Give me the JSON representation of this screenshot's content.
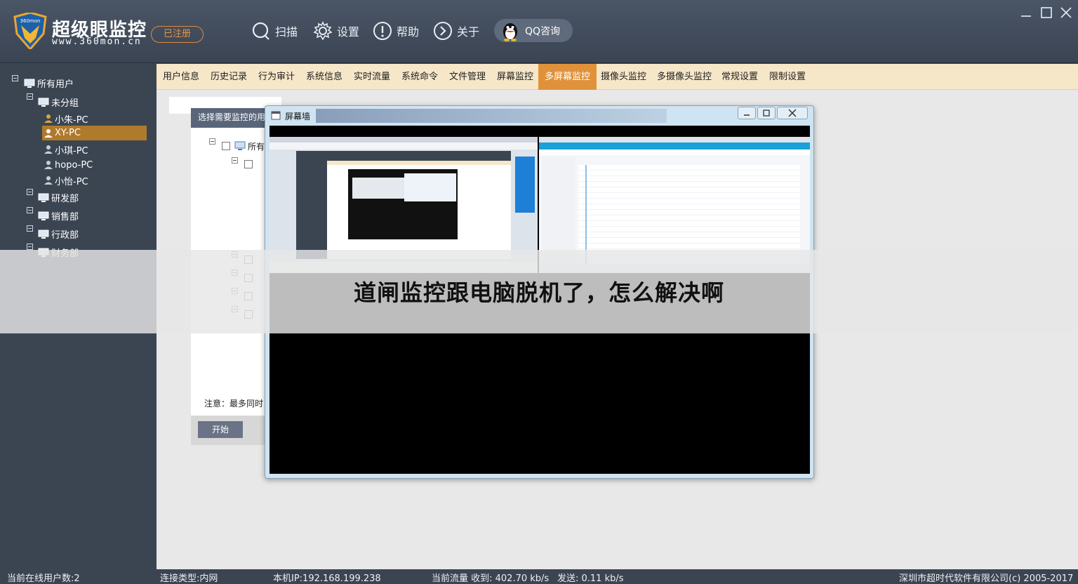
{
  "app": {
    "title": "超级眼监控",
    "url": "www.360mon.cn",
    "badge": "已注册",
    "colors": {
      "accent": "#e0923a",
      "header": "#3b4552",
      "tabbar": "#f7e7c9"
    }
  },
  "nav": {
    "scan": "扫描",
    "settings": "设置",
    "help": "帮助",
    "about": "关于",
    "qq": "QQ咨询"
  },
  "sidebar": {
    "root": "所有用户",
    "groups": [
      {
        "label": "未分组"
      },
      {
        "label": "研发部"
      },
      {
        "label": "销售部"
      },
      {
        "label": "行政部"
      },
      {
        "label": "财务部"
      }
    ],
    "users": [
      "小朱-PC",
      "XY-PC",
      "小琪-PC",
      "hopo-PC",
      "小怡-PC"
    ],
    "selected_user": "XY-PC"
  },
  "tabs": [
    "用户信息",
    "历史记录",
    "行为审计",
    "系统信息",
    "实时流量",
    "系统命令",
    "文件管理",
    "屏幕监控",
    "多屏幕监控",
    "摄像头监控",
    "多摄像头监控",
    "常规设置",
    "限制设置"
  ],
  "active_tab": "多屏幕监控",
  "panel": {
    "header": "选择需要监控的用",
    "tree_root": "所有",
    "note": "注意：最多同时",
    "start_button": "开始"
  },
  "wall": {
    "title": "屏幕墙",
    "icons": {
      "minimize": "minimize-icon",
      "maximize": "maximize-icon",
      "close": "close-icon"
    }
  },
  "overlay": {
    "text": "道闸监控跟电脑脱机了，怎么解决啊"
  },
  "status": {
    "online_users": "当前在线用户数:2",
    "connection": "连接类型:内网",
    "local_ip": "本机IP:192.168.199.238",
    "traffic_recv": "当前流量 收到: 402.70 kb/s",
    "traffic_send": "发送: 0.11 kb/s",
    "copyright": "深圳市超时代软件有限公司(c) 2005-2017"
  }
}
